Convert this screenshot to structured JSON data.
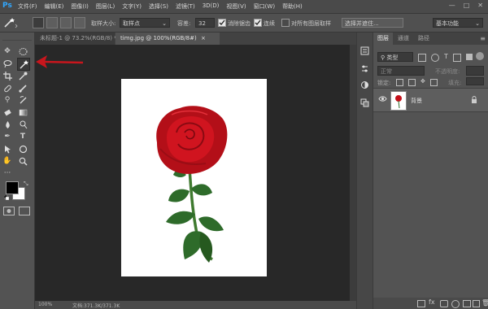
{
  "app": {
    "logo": "Ps",
    "menu": [
      "文件(F)",
      "编辑(E)",
      "图像(I)",
      "图层(L)",
      "文字(Y)",
      "选择(S)",
      "滤镜(T)",
      "3D(D)",
      "视图(V)",
      "窗口(W)",
      "帮助(H)"
    ],
    "window_controls": [
      "—",
      "□",
      "✕"
    ]
  },
  "options": {
    "sample_size_label": "取样大小:",
    "sample_size_value": "取样点",
    "tolerance_label": "容差:",
    "tolerance_value": "32",
    "antialias_label": "消除锯齿",
    "contiguous_label": "连续",
    "all_layers_label": "对所有图层取样",
    "select_subject": "选择并遮住...",
    "workspace": "基本功能"
  },
  "tabs": [
    {
      "label": "未标题-1 @ 73.2%(RGB/8) *",
      "close": "×"
    },
    {
      "label": "timg.jpg @ 100%(RGB/8#)",
      "close": "×"
    }
  ],
  "status": {
    "zoom": "100%",
    "doc": "文档:371.3K/371.3K"
  },
  "panel": {
    "tabs": [
      "图层",
      "通道",
      "路径"
    ],
    "kind_label": "类型",
    "blend_mode": "正常",
    "opacity_label": "不透明度:",
    "lock_label": "锁定:",
    "fill_label": "填充:",
    "layer_name": "背景"
  },
  "colors": {
    "accent": "#31a8ff",
    "annotation_arrow": "#c8161d",
    "rose_red": "#c4101a",
    "leaf_green": "#2e6b2a"
  }
}
